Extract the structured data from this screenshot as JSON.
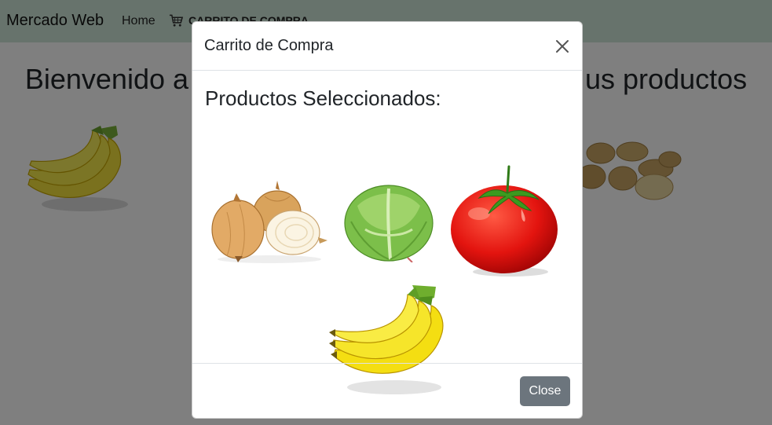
{
  "navbar": {
    "brand": "Mercado Web",
    "home": "Home",
    "cart": "CARRITO DE COMPRA",
    "cart_icon": "cart-icon"
  },
  "page": {
    "welcome_left": "Bienvenido a",
    "welcome_right": "us productos"
  },
  "modal": {
    "title": "Carrito de Compra",
    "close_icon": "close-icon",
    "section_title": "Productos Seleccionados:",
    "products": [
      "onion",
      "lettuce",
      "tomato",
      "banana"
    ],
    "close_button": "Close"
  },
  "colors": {
    "navbar_bg": "#cfe6d8",
    "close_button_bg": "#6c757d",
    "backdrop": "rgba(0,0,0,0.5)"
  }
}
